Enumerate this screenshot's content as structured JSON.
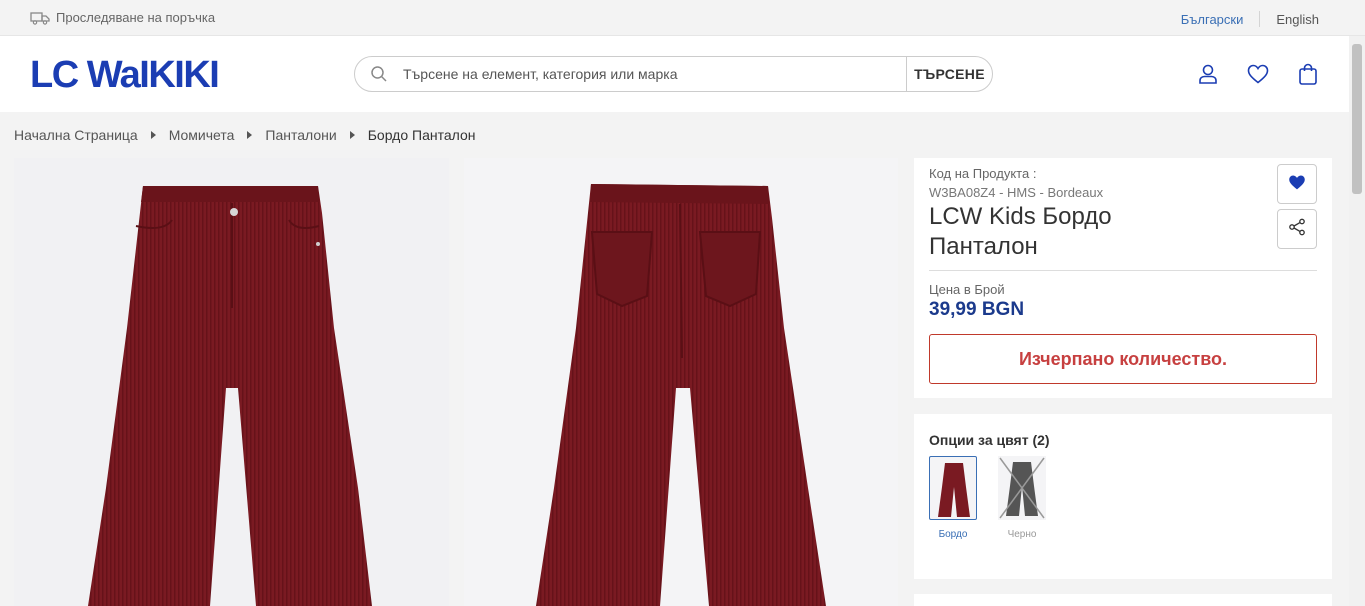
{
  "topbar": {
    "track_label": "Проследяване на поръчка",
    "lang_active": "Български",
    "lang_other": "English"
  },
  "header": {
    "logo": "LC WaIKIKI",
    "search_placeholder": "Търсене на елемент, категория или марка",
    "search_button": "ТЪРСЕНЕ",
    "icons": [
      "user-icon",
      "heart-icon",
      "bag-icon"
    ]
  },
  "breadcrumb": [
    "Начална Страница",
    "Момичета",
    "Панталони",
    "Бордо Панталон"
  ],
  "product": {
    "code_label": "Код на Продукта :",
    "code": "W3BA08Z4 - HMS - Bordeaux",
    "title": "LCW Kids Бордо Панталон",
    "price_label": "Цена в Брой",
    "price": "39,99 BGN",
    "stock_status": "Изчерпано количество."
  },
  "color_options": {
    "title": "Опции за цвят (2)",
    "options": [
      {
        "label": "Бордо",
        "color": "#7a1a22",
        "selected": true,
        "available": true
      },
      {
        "label": "Черно",
        "color": "#555555",
        "selected": false,
        "available": false
      }
    ]
  },
  "colors": {
    "brand_blue": "#1b3db3",
    "price_blue": "#1b3a8c",
    "out_of_stock_red": "#c74040",
    "garment": "#7a1a22"
  }
}
